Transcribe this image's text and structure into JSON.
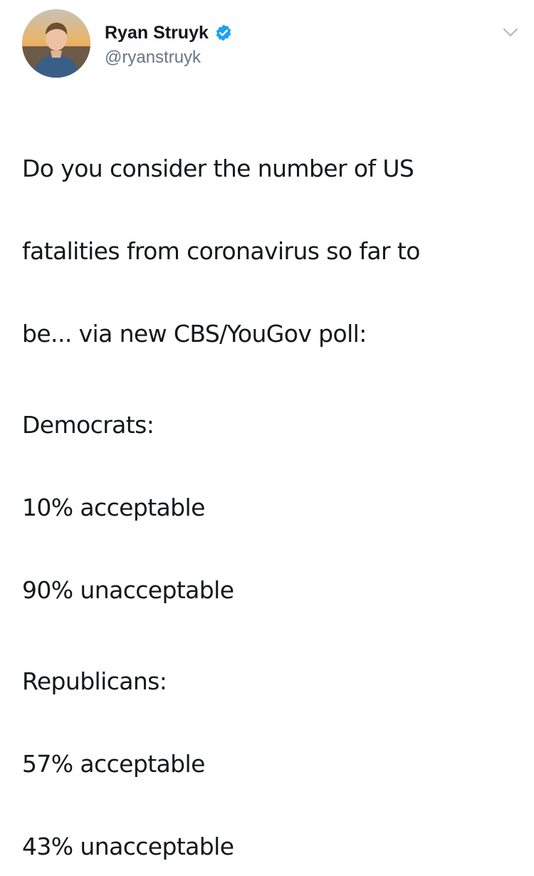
{
  "tweet": {
    "author": {
      "display_name": "Ryan Struyk",
      "handle": "@ryanstruyk",
      "verified": true
    },
    "paragraphs": [
      {
        "lines": [
          "Do you consider the number of US",
          "fatalities from coronavirus so far to",
          "be... via new CBS/YouGov poll:"
        ]
      },
      {
        "lines": [
          "Democrats:",
          "10% acceptable",
          "90% unacceptable"
        ]
      },
      {
        "lines": [
          "Republicans:",
          "57% acceptable",
          "43% unacceptable"
        ]
      }
    ]
  },
  "icons": {
    "verified": "verified-badge-icon",
    "more": "chevron-down-icon"
  },
  "colors": {
    "text": "#14171a",
    "secondary_text": "#657786",
    "verified_blue": "#1da1f2",
    "chevron": "#aab8c2"
  }
}
